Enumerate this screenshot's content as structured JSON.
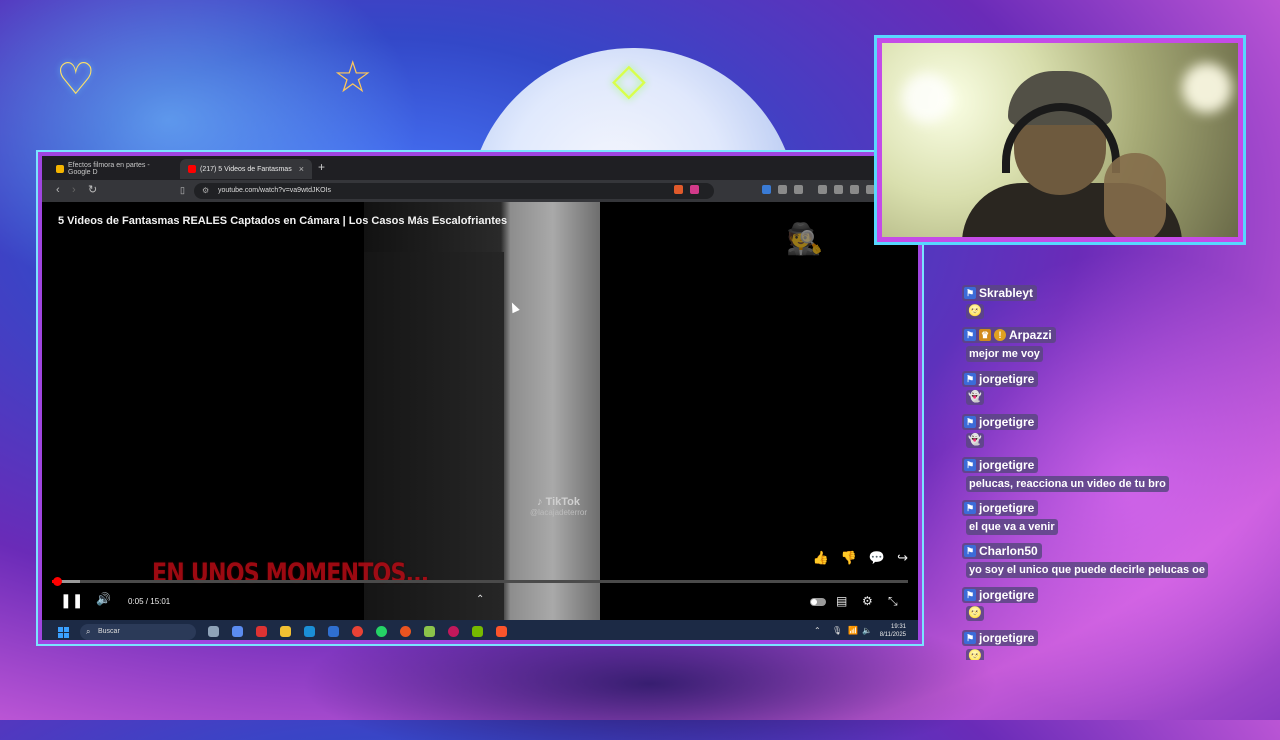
{
  "decor": {
    "heart_icon": "heart-icon",
    "star_icon": "star-icon",
    "gem_icon": "gem-icon"
  },
  "browser": {
    "tabs": [
      {
        "label": "Efectos filmora en partes - Google D",
        "active": false
      },
      {
        "label": "(217) 5 Videos de Fantasmas",
        "active": true,
        "close": "×"
      }
    ],
    "new_tab": "+",
    "minimize": "−",
    "url": "youtube.com/watch?v=va9wtdJKOIs"
  },
  "video": {
    "title": "5 Videos de Fantasmas REALES Captados en Cámara | Los Casos Más Escalofriantes",
    "watermark_brand": "TikTok",
    "watermark_handle": "@lacajadeterror",
    "overlay_text": "EN UNOS MOMENTOS...",
    "time": "0:05 / 15:01",
    "progress_fraction": 0.0055,
    "buffer_fraction": 0.033
  },
  "taskbar": {
    "search_placeholder": "Buscar",
    "clock_time": "19:31",
    "clock_date": "8/11/2025"
  },
  "chat": [
    {
      "user": "Skrableyt",
      "badges": [
        "sub"
      ],
      "emote": "🌝"
    },
    {
      "user": "Arpazzi",
      "badges": [
        "sub",
        "crown",
        "gold"
      ],
      "text": "mejor me voy"
    },
    {
      "user": "jorgetigre",
      "badges": [
        "sub"
      ],
      "emote": "👻"
    },
    {
      "user": "jorgetigre",
      "badges": [
        "sub"
      ],
      "emote": "👻"
    },
    {
      "user": "jorgetigre",
      "badges": [
        "sub"
      ],
      "text": "pelucas, reacciona un video de tu bro"
    },
    {
      "user": "jorgetigre",
      "badges": [
        "sub"
      ],
      "text": "el que va a venir"
    },
    {
      "user": "Charlon50",
      "badges": [
        "sub"
      ],
      "text": "yo soy el unico que puede decirle pelucas oe"
    },
    {
      "user": "jorgetigre",
      "badges": [
        "sub"
      ],
      "emote": "🌝"
    },
    {
      "user": "jorgetigre",
      "badges": [
        "sub"
      ],
      "emote": "🌝"
    }
  ],
  "colors": {
    "accent_purple": "#a045e0",
    "accent_cyan": "#58d7ff",
    "youtube_red": "#ff0000"
  }
}
